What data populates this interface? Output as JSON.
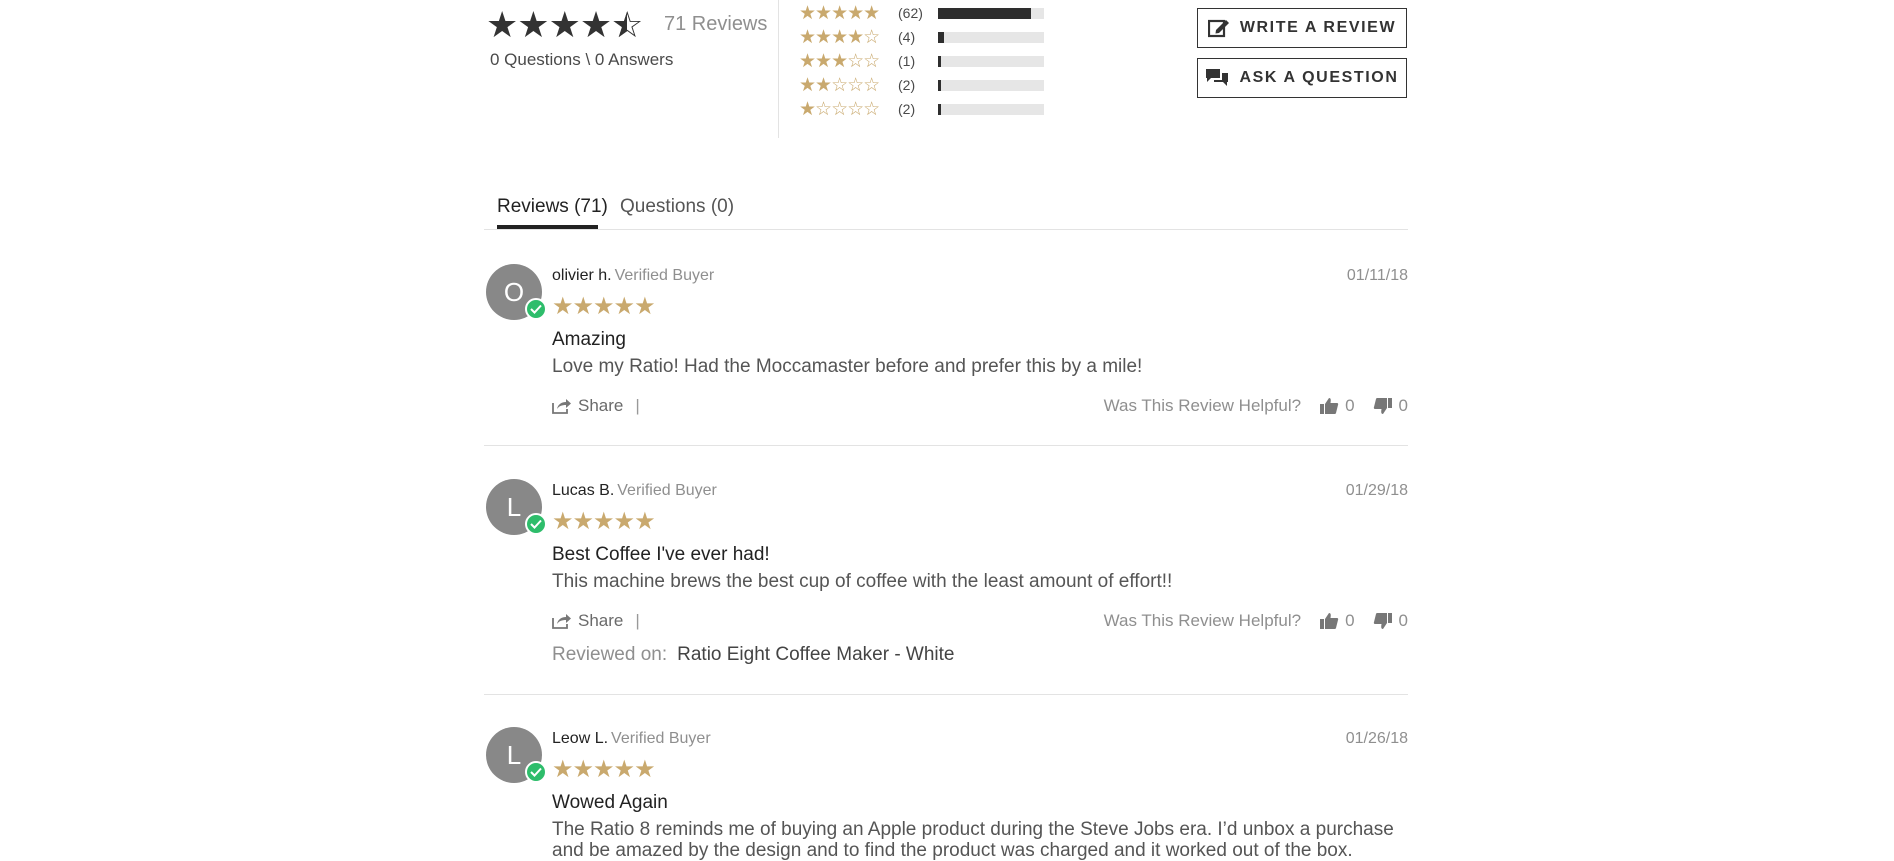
{
  "summary": {
    "average_rating": 4.5,
    "reviews_count_label": "71 Reviews",
    "qa_label": "0 Questions \\ 0 Answers"
  },
  "distribution": [
    {
      "stars": 5,
      "count_label": "(62)",
      "fraction": 0.873
    },
    {
      "stars": 4,
      "count_label": "(4)",
      "fraction": 0.056
    },
    {
      "stars": 3,
      "count_label": "(1)",
      "fraction": 0.014
    },
    {
      "stars": 2,
      "count_label": "(2)",
      "fraction": 0.028
    },
    {
      "stars": 1,
      "count_label": "(2)",
      "fraction": 0.028
    }
  ],
  "actions": {
    "write_review": "WRITE A REVIEW",
    "ask_question": "ASK A QUESTION"
  },
  "tabs": [
    {
      "label": "Reviews (71)",
      "active": true
    },
    {
      "label": "Questions (0)",
      "active": false
    }
  ],
  "reviews": [
    {
      "initial": "O",
      "name": "olivier h.",
      "badge": "Verified Buyer",
      "date": "01/11/18",
      "rating": 5,
      "title": "Amazing",
      "body": "Love my Ratio! Had the Moccamaster before and prefer this by a mile!",
      "share_label": "Share",
      "separator": "|",
      "helpful_label": "Was This Review Helpful?",
      "up_votes": "0",
      "down_votes": "0"
    },
    {
      "initial": "L",
      "name": "Lucas B.",
      "badge": "Verified Buyer",
      "date": "01/29/18",
      "rating": 5,
      "title": "Best Coffee I've ever had!",
      "body": "This machine brews the best cup of coffee with the least amount of effort!!",
      "share_label": "Share",
      "separator": "|",
      "helpful_label": "Was This Review Helpful?",
      "up_votes": "0",
      "down_votes": "0",
      "reviewed_on_label": "Reviewed on:",
      "reviewed_on_value": "Ratio Eight Coffee Maker - White"
    },
    {
      "initial": "L",
      "name": "Leow L.",
      "badge": "Verified Buyer",
      "date": "01/26/18",
      "rating": 5,
      "title": "Wowed Again",
      "body": "The Ratio 8 reminds me of buying an Apple product during the Steve Jobs era. I’d unbox a purchase and be amazed by the design and to find the product was charged and it worked out of the box."
    }
  ],
  "colors": {
    "star_gold": "#c9a96e",
    "star_dark": "#333333",
    "verified_green": "#2ebd6b",
    "avatar_gray": "#888888"
  }
}
